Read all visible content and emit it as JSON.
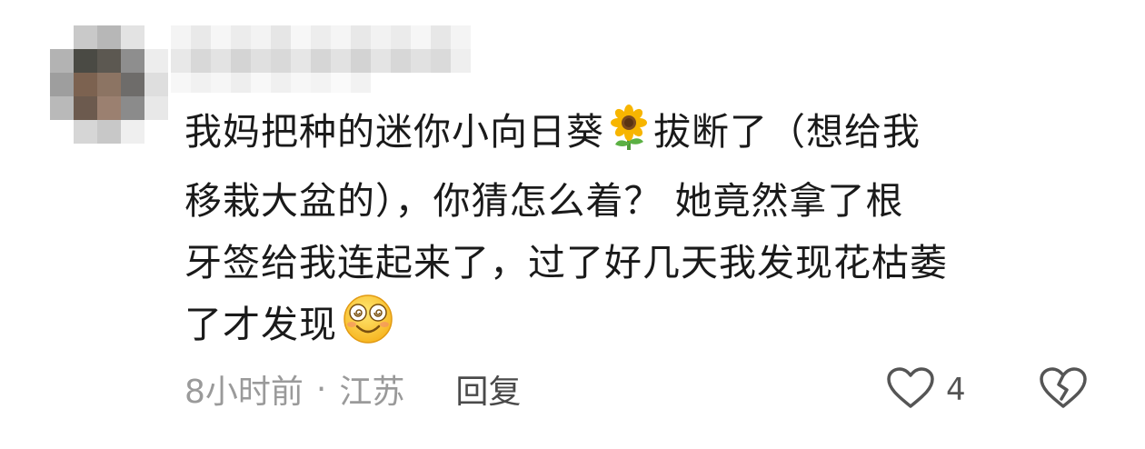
{
  "comment": {
    "text_line1_a": "我妈把种的迷你小向日葵",
    "sunflower_icon": "sunflower-emoji",
    "text_line1_b": "拔断了（想给我",
    "text_line2": "移栽大盆的），你猜怎么着？ 她竟然拿了根",
    "text_line3": "牙签给我连起来了，过了好几天我发现花枯萎",
    "text_line4": "了才发现",
    "end_icon": "dizzy-smiley-emoji",
    "time": "8小时前",
    "separator": "·",
    "location": "江苏",
    "reply_label": "回复",
    "like_count": "4",
    "like_icon": "heart-outline-icon",
    "dislike_icon": "broken-heart-icon"
  },
  "colors": {
    "text": "#1a1a1a",
    "meta": "#9a9a9a",
    "reply": "#4a4a4a",
    "icon": "#555555"
  }
}
